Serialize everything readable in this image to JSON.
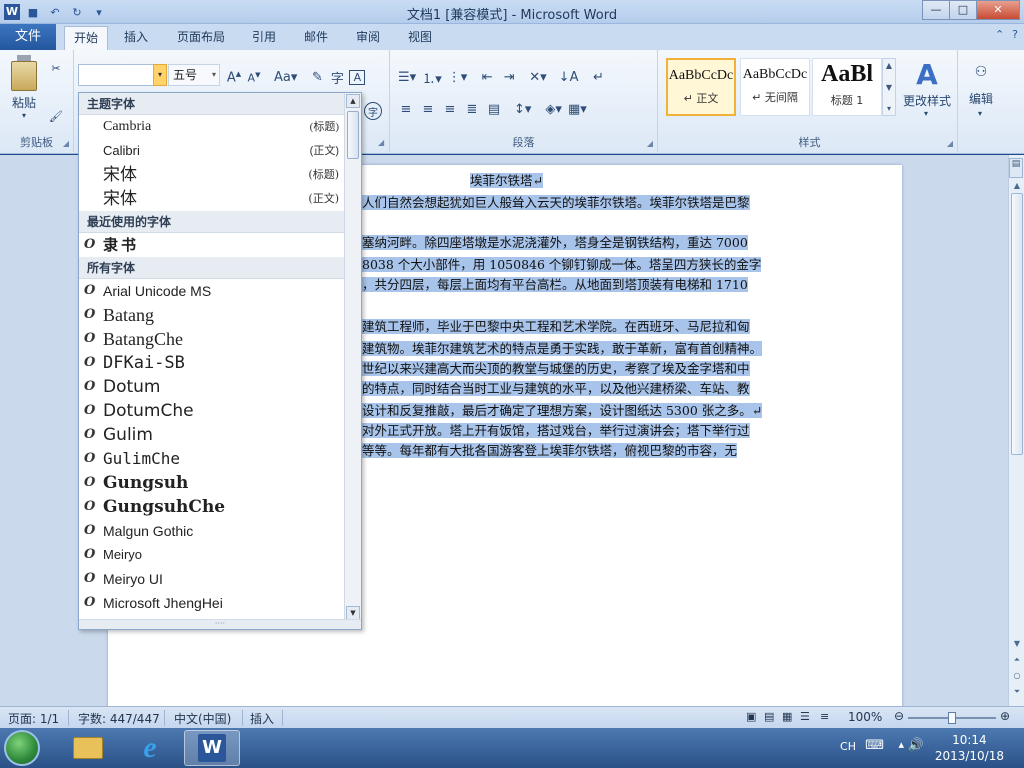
{
  "app": {
    "title": "文档1 [兼容模式] - Microsoft Word"
  },
  "window_controls": {
    "minimize": "—",
    "maximize": "□",
    "close": "✕"
  },
  "ribbon_tabs": [
    {
      "label": "文件"
    },
    {
      "label": "开始"
    },
    {
      "label": "插入"
    },
    {
      "label": "页面布局"
    },
    {
      "label": "引用"
    },
    {
      "label": "邮件"
    },
    {
      "label": "审阅"
    },
    {
      "label": "视图"
    }
  ],
  "ribbon": {
    "clipboard": {
      "paste_label": "粘贴",
      "group_label": "剪贴板"
    },
    "font": {
      "current_font": "",
      "size": "五号"
    },
    "paragraph": {
      "group_label": "段落"
    },
    "styles": {
      "group_label": "样式",
      "items": [
        {
          "sample": "AaBbCcDc",
          "name": "↵ 正文"
        },
        {
          "sample": "AaBbCcDc",
          "name": "↵ 无间隔"
        },
        {
          "sample": "AaBl",
          "name": "标题 1"
        }
      ],
      "change_styles": "更改样式"
    },
    "editing": {
      "label": "编辑"
    }
  },
  "font_dropdown": {
    "theme_header": "主题字体",
    "theme_fonts": [
      {
        "name": "Cambria",
        "tag": "(标题)"
      },
      {
        "name": "Calibri",
        "tag": "(正文)"
      },
      {
        "name": "宋体",
        "tag": "(标题)"
      },
      {
        "name": "宋体",
        "tag": "(正文)"
      }
    ],
    "recent_header": "最近使用的字体",
    "recent_fonts": [
      {
        "name": "隶书"
      }
    ],
    "all_header": "所有字体",
    "all_fonts": [
      {
        "name": "Arial Unicode MS"
      },
      {
        "name": "Batang"
      },
      {
        "name": "BatangChe"
      },
      {
        "name": "DFKai-SB"
      },
      {
        "name": "Dotum"
      },
      {
        "name": "DotumChe"
      },
      {
        "name": "Gulim"
      },
      {
        "name": "GulimChe"
      },
      {
        "name": "Gungsuh"
      },
      {
        "name": "GungsuhChe"
      },
      {
        "name": "Malgun Gothic"
      },
      {
        "name": "Meiryo"
      },
      {
        "name": "Meiryo UI"
      },
      {
        "name": "Microsoft JhengHei"
      }
    ]
  },
  "document": {
    "title": "埃菲尔铁塔↵",
    "lines": [
      "人们自然会想起犹如巨人般耸入云天的埃菲尔铁塔。埃菲尔铁塔是巴黎",
      "塞纳河畔。除四座塔墩是水泥浇灌外，塔身全是钢铁结构，重达 7000",
      "8038 个大小部件，用 1050846 个铆钉铆成一体。塔呈四方狭长的金字",
      "，共分四层，每层上面均有平台高栏。从地面到塔顶装有电梯和 1710",
      "建筑工程师，毕业于巴黎中央工程和艺术学院。在西班牙、马尼拉和匈",
      "建筑物。埃菲尔建筑艺术的特点是勇于实践，敢于革新，富有首创精神。",
      "世纪以来兴建高大而尖顶的教堂与城堡的历史，考察了埃及金字塔和中",
      "的特点，同时结合当时工业与建筑的水平，以及他兴建桥梁、车站、教",
      "设计和反复推敲，最后才确定了理想方案，设计图纸达 5300 张之多。↵",
      "对外正式开放。塔上开有饭馆，搭过戏台，举行过演讲会；塔下举行过",
      "等等。每年都有大批各国游客登上埃菲尔铁塔，俯视巴黎的市容，无"
    ]
  },
  "statusbar": {
    "page": "页面: 1/1",
    "words": "字数: 447/447",
    "language": "中文(中国)",
    "mode": "插入",
    "zoom": "100%",
    "zoom_level": 1.0
  },
  "taskbar": {
    "lang": "CH",
    "time": "10:14",
    "date": "2013/10/18"
  },
  "colors": {
    "selection": "#a8c4ea",
    "ribbon_file_tab": "#2b579a",
    "font_box_dropdown": "#ffd36a"
  }
}
